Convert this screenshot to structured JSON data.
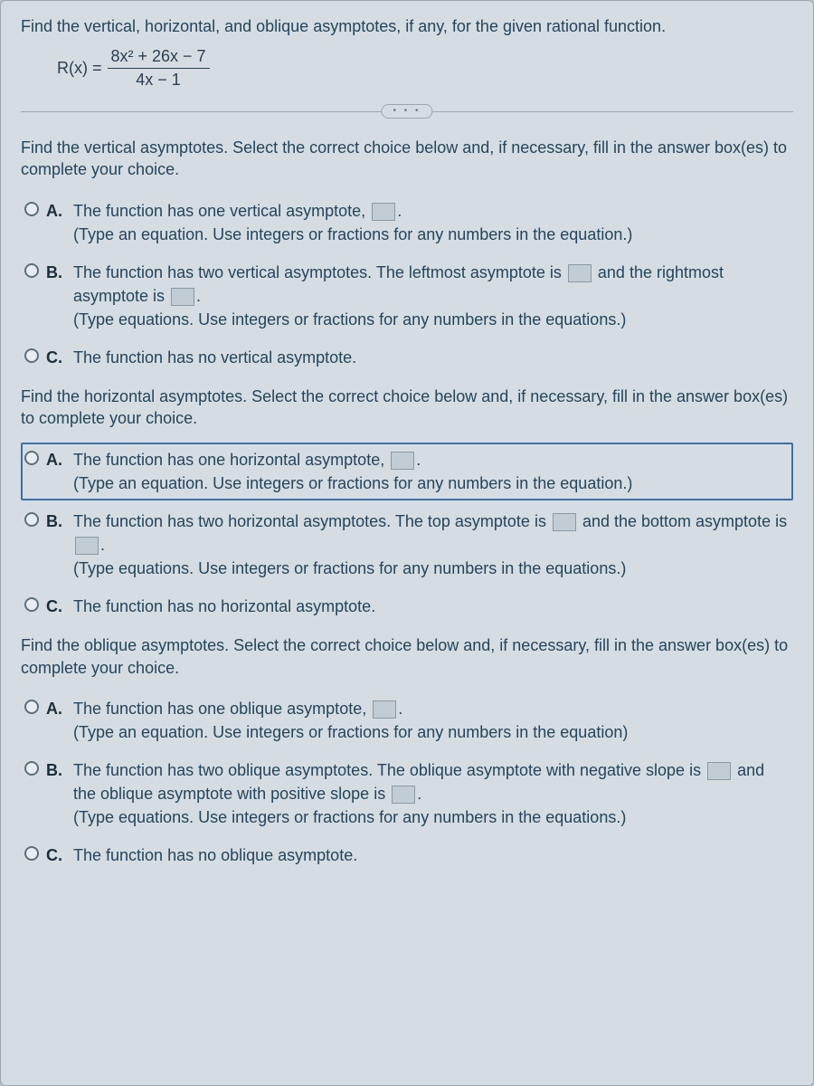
{
  "header": "Find the vertical, horizontal, and oblique asymptotes, if any, for the given rational function.",
  "equation": {
    "lhs": "R(x) =",
    "numerator": "8x² + 26x − 7",
    "denominator": "4x − 1"
  },
  "dots": "• • •",
  "sections": {
    "vertical": {
      "prompt": "Find the vertical asymptotes. Select the correct choice below and, if necessary, fill in the answer box(es) to complete your choice.",
      "A": {
        "main": "The function has one vertical asymptote, ",
        "after": ".",
        "hint": "(Type an equation. Use integers or fractions for any numbers in the equation.)"
      },
      "B": {
        "p1": "The function has two vertical asymptotes. The leftmost asymptote is ",
        "p2": " and the rightmost asymptote is ",
        "after": ".",
        "hint": "(Type equations. Use integers or fractions for any numbers in the equations.)"
      },
      "C": {
        "main": "The function has no vertical asymptote."
      }
    },
    "horizontal": {
      "prompt": "Find the horizontal asymptotes. Select the correct choice below and, if necessary, fill in the answer box(es) to complete your choice.",
      "A": {
        "main": "The function has one horizontal asymptote, ",
        "after": ".",
        "hint": "(Type an equation. Use integers or fractions for any numbers in the equation.)"
      },
      "B": {
        "p1": "The function has two horizontal asymptotes. The top asymptote is ",
        "p2": " and the bottom asymptote is ",
        "after": ".",
        "hint": "(Type equations. Use integers or fractions for any numbers in the equations.)"
      },
      "C": {
        "main": "The function has no horizontal asymptote."
      }
    },
    "oblique": {
      "prompt": "Find the oblique asymptotes. Select the correct choice below and, if necessary, fill in the answer box(es) to complete your choice.",
      "A": {
        "main": "The function has one oblique asymptote, ",
        "after": ".",
        "hint": "(Type an equation. Use integers or fractions for any numbers in the equation)"
      },
      "B": {
        "p1": "The function has two oblique asymptotes. The oblique asymptote with negative slope is ",
        "p2": " and the oblique asymptote with positive slope is ",
        "after": ".",
        "hint": "(Type equations. Use integers or fractions for any numbers in the equations.)"
      },
      "C": {
        "main": "The function has no oblique asymptote."
      }
    }
  },
  "labels": {
    "A": "A.",
    "B": "B.",
    "C": "C."
  }
}
